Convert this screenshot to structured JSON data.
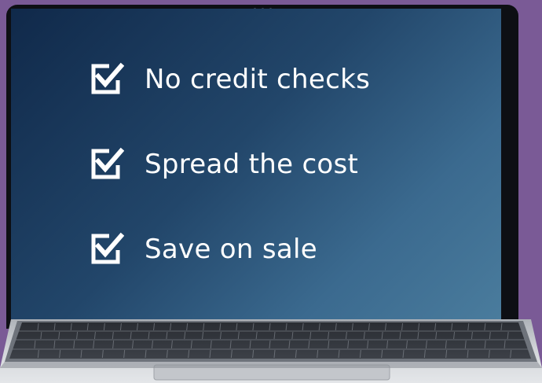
{
  "screen": {
    "checklist": [
      {
        "label": "No credit checks",
        "icon": "checkbox-checked-icon"
      },
      {
        "label": "Spread the cost",
        "icon": "checkbox-checked-icon"
      },
      {
        "label": "Save on sale",
        "icon": "checkbox-checked-icon"
      }
    ]
  },
  "colors": {
    "background": "#7a5a96",
    "screen_gradient_start": "#10294a",
    "screen_gradient_end": "#4a7c9d",
    "text": "#ffffff",
    "laptop_body": "#c9ccd1"
  }
}
